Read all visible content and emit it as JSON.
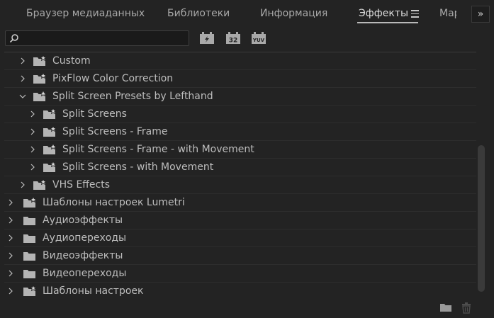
{
  "tabs": [
    {
      "label": "Браузер медиаданных",
      "active": false
    },
    {
      "label": "Библиотеки",
      "active": false
    },
    {
      "label": "Информация",
      "active": false
    },
    {
      "label": "Эффекты",
      "active": true
    },
    {
      "label": "Мар",
      "active": false
    }
  ],
  "overflow_label": "»",
  "search": {
    "value": "",
    "placeholder": ""
  },
  "toolbar": {
    "accelerated_label": "",
    "bit32_label": "32",
    "yuv_label": "YUV"
  },
  "tree": [
    {
      "label": "Custom",
      "level": 1,
      "expanded": false,
      "icon": "preset-folder-icon"
    },
    {
      "label": "PixFlow Color Correction",
      "level": 1,
      "expanded": false,
      "icon": "preset-folder-icon"
    },
    {
      "label": "Split Screen Presets by Lefthand",
      "level": 1,
      "expanded": true,
      "icon": "preset-folder-icon"
    },
    {
      "label": "Split Screens",
      "level": 2,
      "expanded": false,
      "icon": "preset-folder-icon"
    },
    {
      "label": "Split Screens - Frame",
      "level": 2,
      "expanded": false,
      "icon": "preset-folder-icon"
    },
    {
      "label": "Split Screens - Frame - with Movement",
      "level": 2,
      "expanded": false,
      "icon": "preset-folder-icon"
    },
    {
      "label": "Split Screens - with Movement",
      "level": 2,
      "expanded": false,
      "icon": "preset-folder-icon"
    },
    {
      "label": "VHS Effects",
      "level": 1,
      "expanded": false,
      "icon": "preset-folder-icon"
    },
    {
      "label": "Шаблоны настроек Lumetri",
      "level": 0,
      "expanded": false,
      "icon": "preset-folder-icon"
    },
    {
      "label": "Аудиоэффекты",
      "level": 0,
      "expanded": false,
      "icon": "folder-icon"
    },
    {
      "label": "Аудиопереходы",
      "level": 0,
      "expanded": false,
      "icon": "folder-icon"
    },
    {
      "label": "Видеоэффекты",
      "level": 0,
      "expanded": false,
      "icon": "folder-icon"
    },
    {
      "label": "Видеопереходы",
      "level": 0,
      "expanded": false,
      "icon": "folder-icon"
    },
    {
      "label": "Шаблоны настроек",
      "level": 0,
      "expanded": false,
      "icon": "preset-folder-icon"
    }
  ],
  "colors": {
    "background": "#232323",
    "text": "#bdbdbd",
    "active_tab": "#dcdcdc"
  }
}
